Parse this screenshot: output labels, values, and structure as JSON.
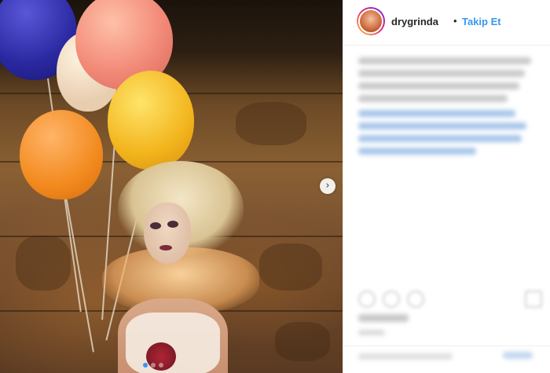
{
  "post": {
    "username": "drygrinda",
    "separator": "•",
    "follow_label": "Takip Et",
    "caption": "",
    "slides": {
      "count": 3,
      "active": 1
    }
  },
  "icons": {
    "next": "chevron-right-icon",
    "like": "heart-icon",
    "comment": "comment-icon",
    "share": "share-icon",
    "save": "bookmark-icon"
  },
  "colors": {
    "link_blue": "#3897f0",
    "text_dark": "#262626",
    "border": "#efefef"
  }
}
